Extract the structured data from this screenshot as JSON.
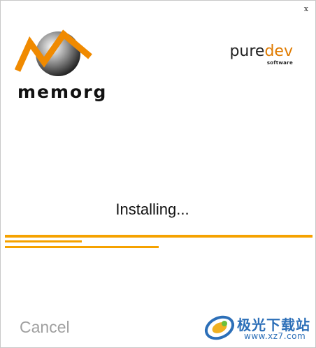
{
  "window": {
    "close_label": "x"
  },
  "branding": {
    "product_name": "memorg",
    "vendor_name_main": "pure",
    "vendor_name_accent": "dev",
    "vendor_tagline": "software",
    "accent_color": "#f5a200"
  },
  "status": {
    "text": "Installing...",
    "progress_bars": [
      {
        "name": "overall-progress",
        "fraction": 1.0
      },
      {
        "name": "step-progress",
        "fraction": 0.25
      },
      {
        "name": "file-progress",
        "fraction": 0.5
      }
    ]
  },
  "actions": {
    "cancel_label": "Cancel"
  },
  "watermark": {
    "site_name": "极光下载站",
    "url": "www.xz7.com"
  }
}
